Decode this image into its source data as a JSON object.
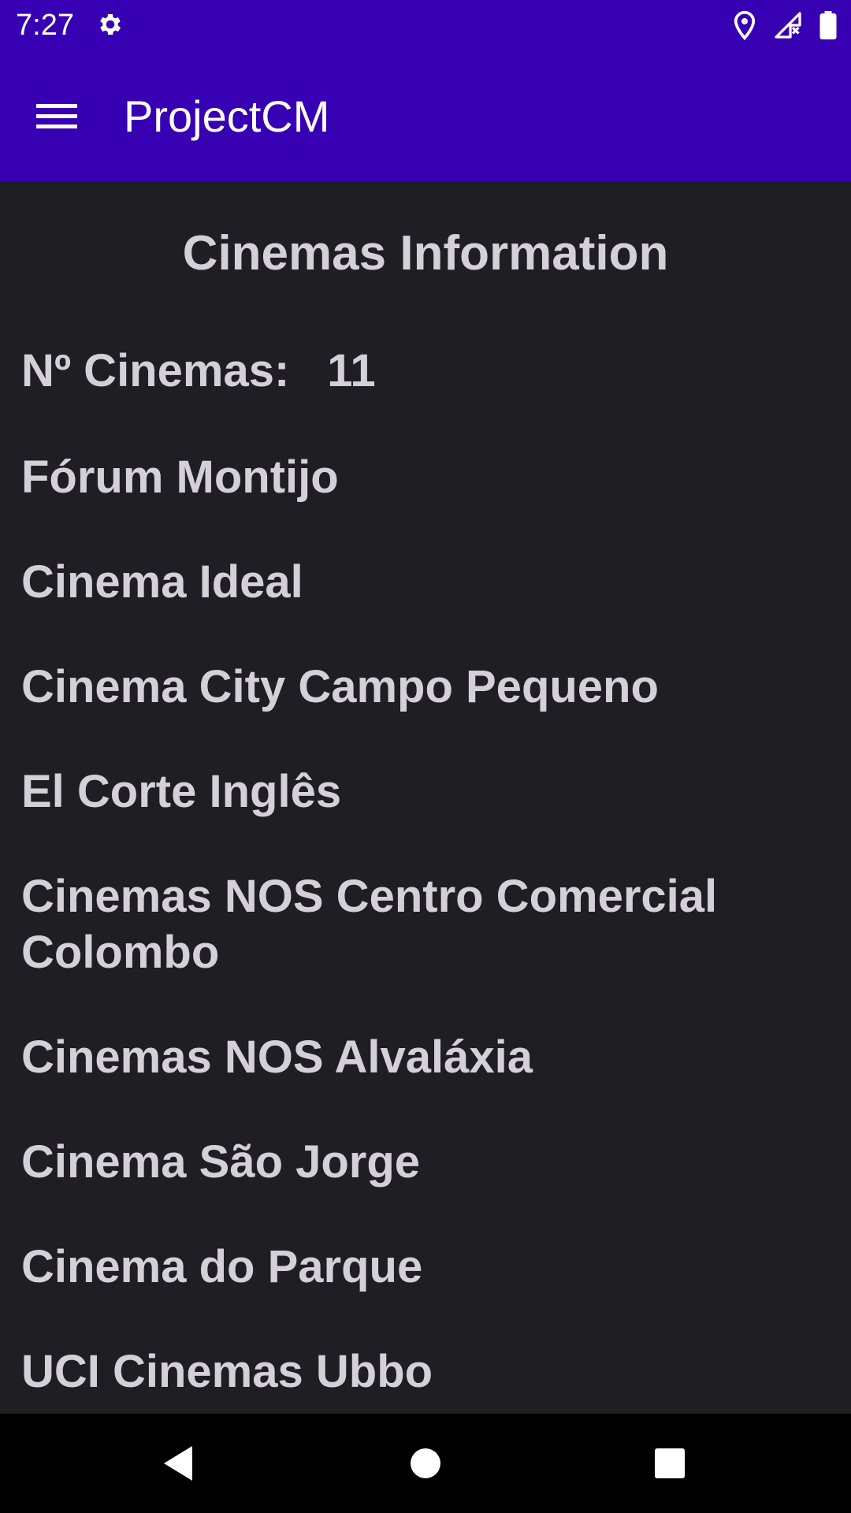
{
  "status_bar": {
    "time": "7:27",
    "icons": [
      "settings-gear-icon",
      "location-pin-icon",
      "cell-signal-no-data-icon",
      "battery-full-icon"
    ]
  },
  "app_bar": {
    "title": "ProjectCM",
    "menu_icon": "hamburger-menu-icon"
  },
  "page": {
    "heading": "Cinemas Information",
    "count_label": "Nº Cinemas:",
    "count_value": "11",
    "cinemas": [
      "Fórum Montijo",
      "Cinema Ideal",
      "Cinema City Campo Pequeno",
      "El Corte Inglês",
      "Cinemas NOS Centro Comercial Colombo",
      "Cinemas NOS Alvaláxia",
      "Cinema São Jorge",
      "Cinema do Parque",
      "UCI Cinemas Ubbo"
    ]
  },
  "nav_bar": {
    "icons": [
      "back-triangle-icon",
      "home-circle-icon",
      "recents-square-icon"
    ]
  },
  "colors": {
    "app_bar": "#3700b3",
    "background": "#1f1e23",
    "text": "#d4cfd9",
    "nav_bar": "#000000"
  }
}
